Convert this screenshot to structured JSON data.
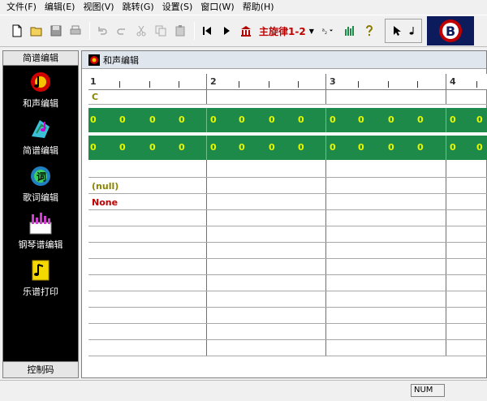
{
  "menu": [
    "文件(F)",
    "编辑(E)",
    "视图(V)",
    "跳转(G)",
    "设置(S)",
    "窗口(W)",
    "帮助(H)"
  ],
  "toolbar": {
    "melody_label": "主旋律1-2",
    "buttons": [
      "new-icon",
      "open-icon",
      "save-icon",
      "print-icon",
      "undo-icon",
      "redo-icon",
      "cut-icon",
      "copy-icon",
      "paste-icon",
      "skip-back-icon",
      "play-icon",
      "library-icon"
    ]
  },
  "left_panel": {
    "header": "简谱编辑",
    "items": [
      {
        "label": "和声编辑",
        "icon": "harmony-icon"
      },
      {
        "label": "简谱编辑",
        "icon": "notation-icon"
      },
      {
        "label": "歌词编辑",
        "icon": "lyrics-icon"
      },
      {
        "label": "钢琴谱编辑",
        "icon": "piano-icon"
      },
      {
        "label": "乐谱打印",
        "icon": "print-score-icon"
      }
    ],
    "footer": "控制码"
  },
  "child_window": {
    "title": "和声编辑",
    "measures": [
      "1",
      "2",
      "3",
      "4"
    ],
    "chord_text": "C",
    "zero": "0",
    "null_text": "(null)",
    "none_text": "None"
  },
  "status": {
    "num": "NUM"
  }
}
